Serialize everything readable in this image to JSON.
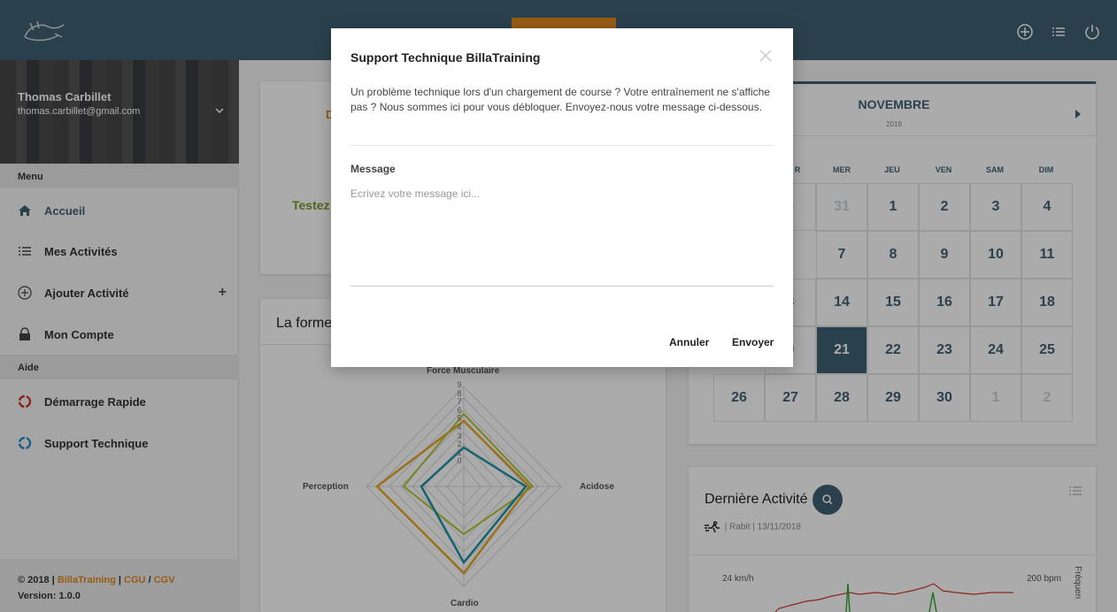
{
  "header": {
    "icons": [
      "logo-icon",
      "add-circle-icon",
      "list-icon",
      "power-icon"
    ]
  },
  "sidebar": {
    "user_name": "Thomas Carbillet",
    "user_email": "thomas.carbillet@gmail.com",
    "menu_heading": "Menu",
    "items": [
      {
        "label": "Accueil",
        "icon": "home-icon"
      },
      {
        "label": "Mes Activités",
        "icon": "list-icon"
      },
      {
        "label": "Ajouter Activité",
        "icon": "add-circle-icon"
      },
      {
        "label": "Mon Compte",
        "icon": "lock-icon"
      }
    ],
    "help_heading": "Aide",
    "help_items": [
      {
        "label": "Démarrage Rapide",
        "icon": "ring-red-icon"
      },
      {
        "label": "Support Technique",
        "icon": "ring-blue-icon"
      }
    ],
    "footer_copy": "© 2018 |",
    "footer_brand": "BillaTraining",
    "footer_sep1": "|",
    "footer_cgu": "CGU",
    "footer_slash": "/",
    "footer_cgv": "CGV",
    "version": "Version: 1.0.0"
  },
  "main": {
    "card_partial_letter": "D",
    "test_text": "Testez",
    "forme_title": "La forme",
    "radar": {
      "axes": [
        "Force Musculaire",
        "Acidose",
        "Cardio",
        "Perception"
      ],
      "scale": [
        "9",
        "8",
        "7",
        "6",
        "5",
        "4",
        "3",
        "2",
        "1",
        "0"
      ]
    },
    "calendar": {
      "month": "NOVEMBRE",
      "year": "2018",
      "days": [
        "R",
        "MER",
        "JEU",
        "VEN",
        "SAM",
        "DIM"
      ],
      "rows": [
        [
          "0",
          "31",
          "1",
          "2",
          "3",
          "4"
        ],
        [
          "",
          "7",
          "8",
          "9",
          "10",
          "11"
        ],
        [
          "3",
          "14",
          "15",
          "16",
          "17",
          "18"
        ],
        [
          "0",
          "21",
          "22",
          "23",
          "24",
          "25"
        ],
        [
          "26",
          "27",
          "28",
          "29",
          "30",
          "1",
          "2"
        ]
      ]
    },
    "last_activity": {
      "title": "Dernière Activité",
      "subtitle": "| Rabit | 13/11/2018",
      "left_scale": "24 km/h",
      "right_scale": "200 bpm",
      "side_label": "Fréquen"
    }
  },
  "modal": {
    "title": "Support Technique BillaTraining",
    "description": "Un problème technique lors d'un chargement de course ? Votre entraînement ne s'affiche pas ? Nous sommes ici pour vous débloquer. Envoyez-nous votre message ci-dessous.",
    "message_label": "Message",
    "message_placeholder": "Ecrivez votre message ici...",
    "cancel_label": "Annuler",
    "send_label": "Envoyer"
  },
  "colors": {
    "header": "#3f6273",
    "accent": "#e08a1e",
    "green": "#7a9a2e"
  }
}
